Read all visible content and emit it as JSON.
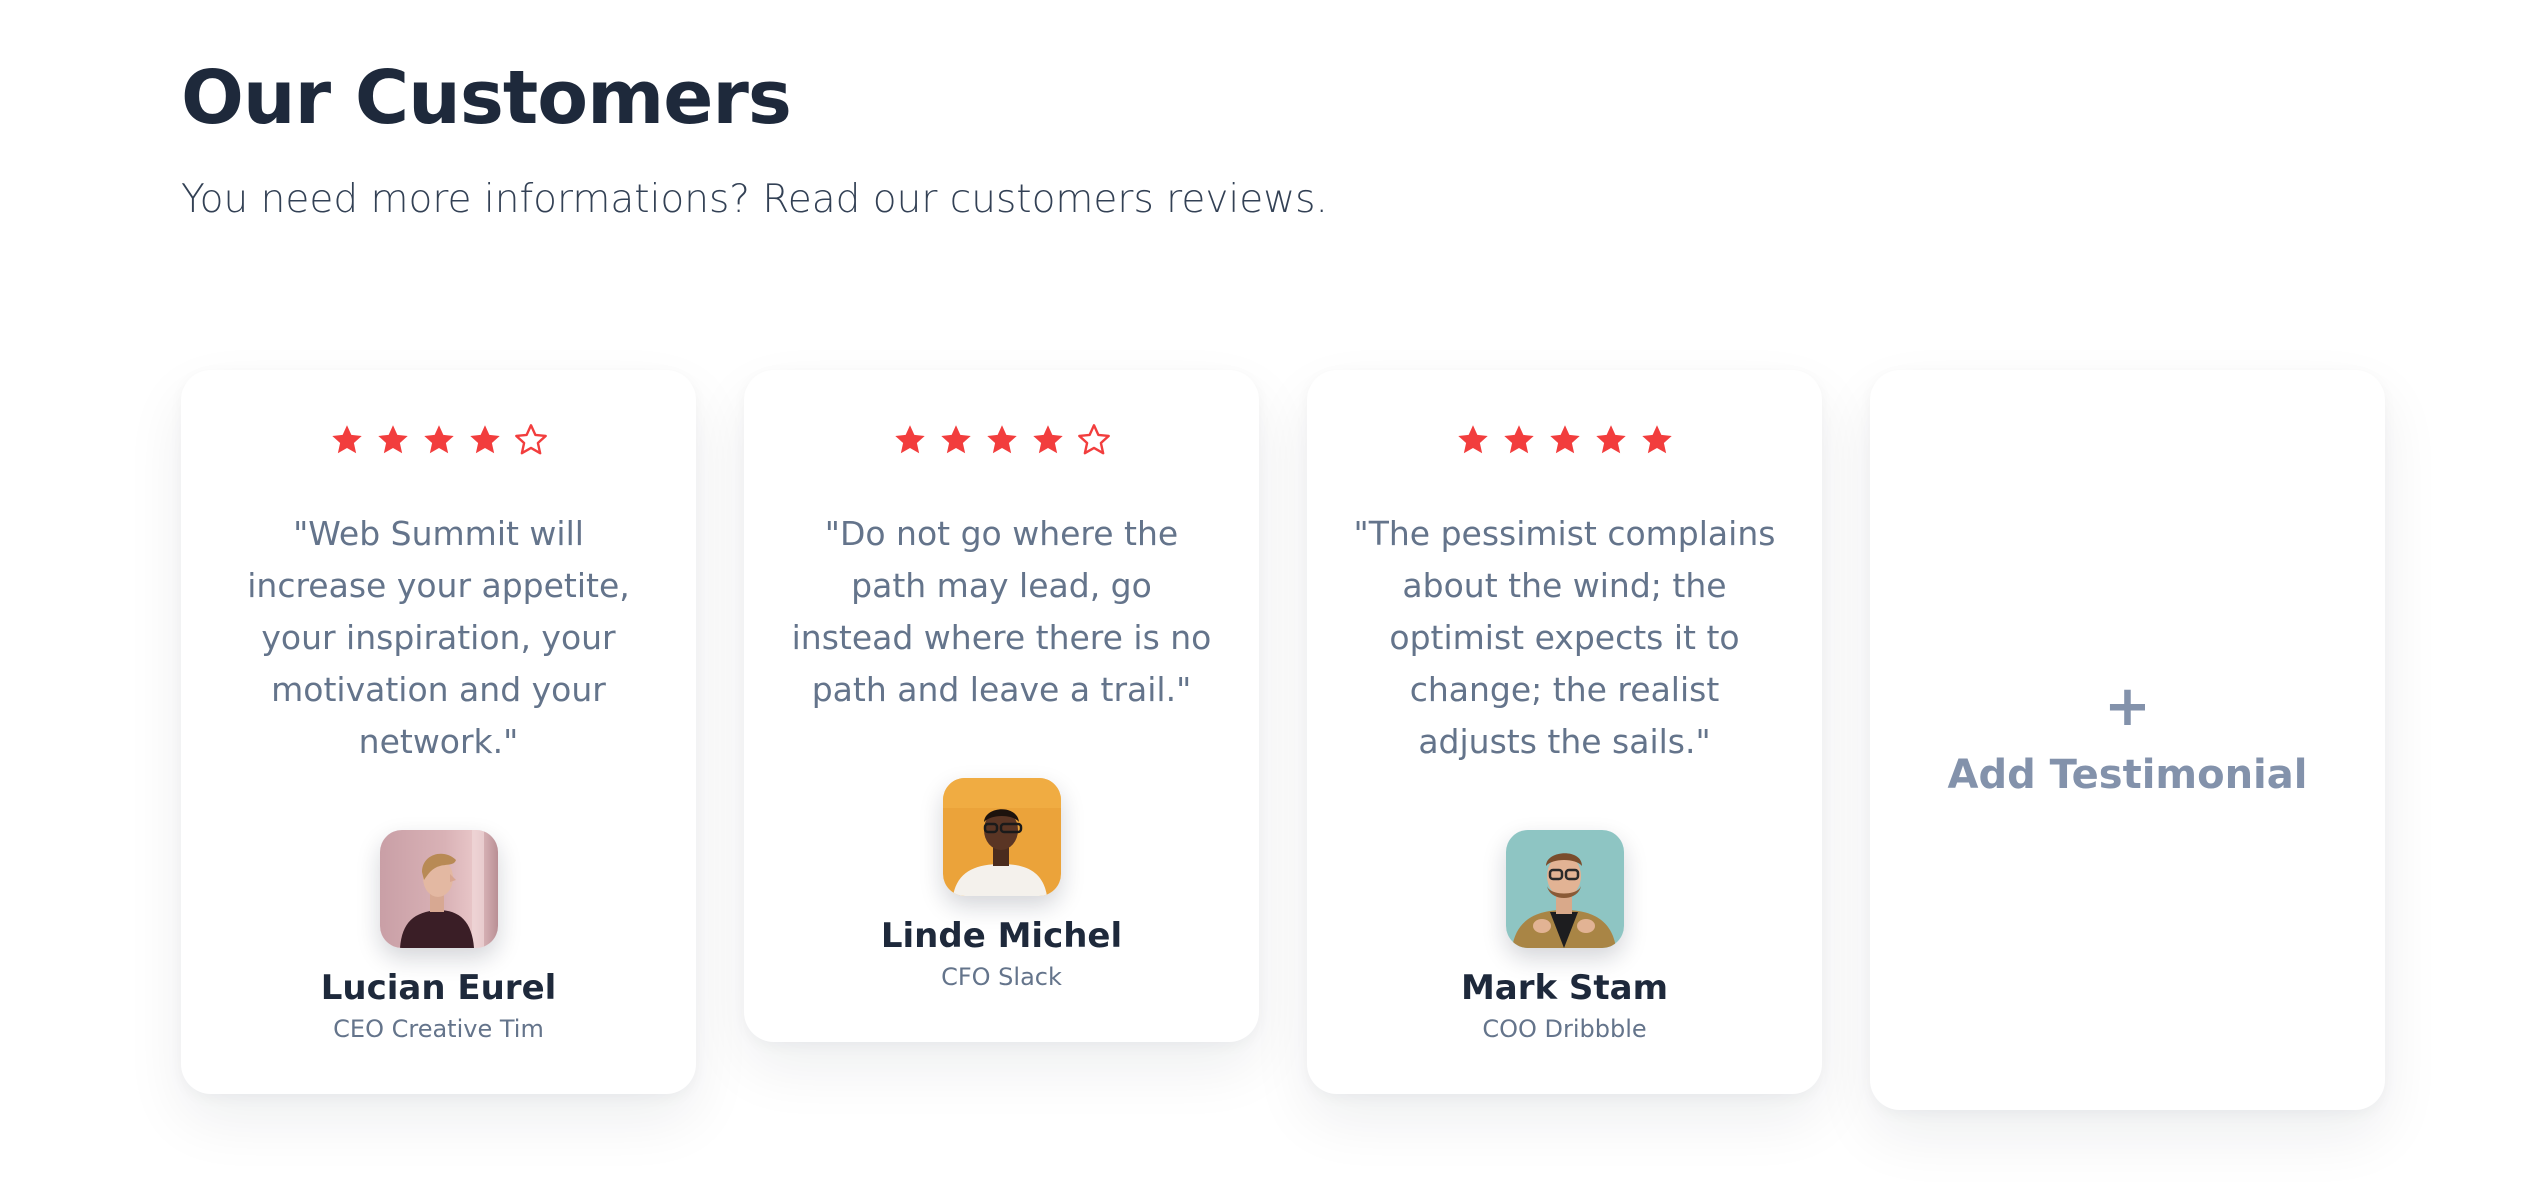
{
  "header": {
    "title": "Our Customers",
    "subtitle": "You need more informations? Read our customers reviews."
  },
  "colors": {
    "star": "#f23d3d",
    "heading": "#1e293b",
    "muted": "#64748b",
    "add": "#8392ab"
  },
  "testimonials": [
    {
      "rating": 4,
      "max_rating": 5,
      "quote": "\"Web Summit will increase your appetite, your inspiration, your motivation and your network.\"",
      "avatar_icon": "portrait-man-blond-profile",
      "name": "Lucian Eurel",
      "role": "CEO Creative Tim"
    },
    {
      "rating": 4,
      "max_rating": 5,
      "quote": "\"Do not go where the path may lead, go instead where there is no path and leave a trail.\"",
      "avatar_icon": "portrait-man-glasses-orange-background",
      "name": "Linde Michel",
      "role": "CFO Slack"
    },
    {
      "rating": 5,
      "max_rating": 5,
      "quote": "\"The pessimist complains about the wind; the optimist expects it to change; the realist adjusts the sails.\"",
      "avatar_icon": "portrait-man-beard-glasses-teal-background",
      "name": "Mark Stam",
      "role": "COO Dribbble"
    }
  ],
  "add_card": {
    "icon": "plus-icon",
    "plus": "+",
    "label": "Add Testimonial"
  }
}
